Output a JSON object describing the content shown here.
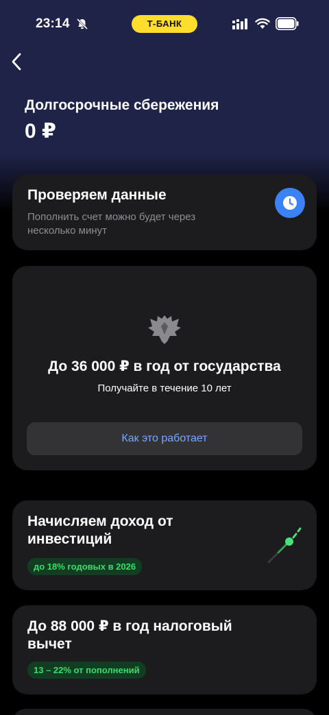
{
  "status_bar": {
    "time": "23:14",
    "carrier": "Т-БАНК",
    "icons": [
      "bell-slash-icon",
      "signal-icon",
      "wifi-icon",
      "battery-icon"
    ]
  },
  "header": {
    "back_icon": "chevron-left-icon",
    "title": "Долгосрочные сбережения",
    "balance": "0 ₽"
  },
  "status_card": {
    "title": "Проверяем данные",
    "description": "Пополнить счет можно будет через несколько минут",
    "icon": "clock-icon"
  },
  "gov_card": {
    "icon": "emblem-icon",
    "title": "До 36 000 ₽ в год от государства",
    "subtitle": "Получайте в течение 10 лет",
    "button_label": "Как это работает"
  },
  "invest_card": {
    "title": "Начисляем доход от инвестиций",
    "badge": "до 18% годовых в 2026",
    "icon": "growth-icon"
  },
  "tax_card": {
    "title": "До 88 000 ₽ в год налоговый вычет",
    "badge": "13 – 22% от пополнений"
  },
  "colors": {
    "hero_bg": "#1f2347",
    "card_bg": "#1c1c1e",
    "accent_yellow": "#ffdd2d",
    "link_blue": "#7aa7ff",
    "badge_green": "#3ddc6a",
    "clock_blue": "#3b82f6"
  }
}
